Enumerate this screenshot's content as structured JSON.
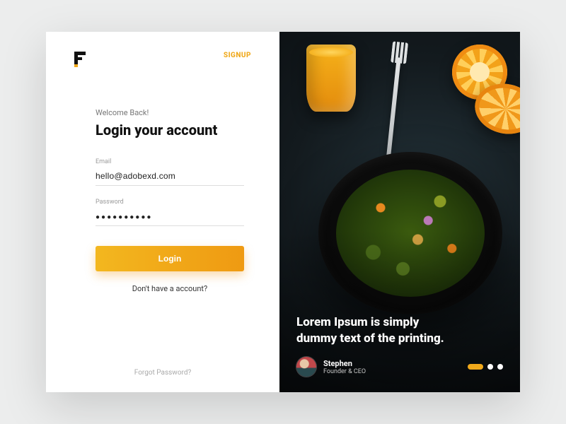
{
  "brand": {
    "letter": "F"
  },
  "nav": {
    "signup": "SIGNUP"
  },
  "welcome": "Welcome Back!",
  "heading": "Login your account",
  "fields": {
    "email": {
      "label": "Email",
      "value": "hello@adobexd.com"
    },
    "password": {
      "label": "Password",
      "value": "●●●●●●●●●●"
    }
  },
  "buttons": {
    "login": "Login"
  },
  "links": {
    "no_account": "Don't have a account?",
    "forgot": "Forgot Password?"
  },
  "hero": {
    "quote": "Lorem Ipsum is simply dummy text of the printing.",
    "author": {
      "name": "Stephen",
      "role": "Founder & CEO"
    },
    "slides": {
      "count": 3,
      "active_index": 0
    }
  },
  "colors": {
    "accent": "#f0a91b"
  }
}
